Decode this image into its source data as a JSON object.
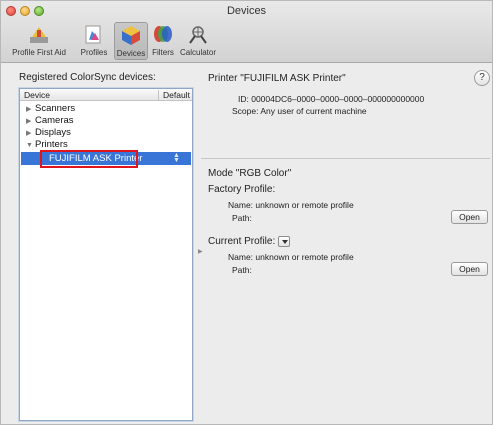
{
  "window": {
    "title": "Devices"
  },
  "toolbar": {
    "items": [
      {
        "label": "Profile First Aid",
        "icon": "first-aid-icon"
      },
      {
        "label": "Profiles",
        "icon": "profiles-icon"
      },
      {
        "label": "Devices",
        "icon": "devices-icon",
        "selected": true
      },
      {
        "label": "Filters",
        "icon": "filters-icon"
      },
      {
        "label": "Calculator",
        "icon": "calculator-icon"
      }
    ]
  },
  "left": {
    "title": "Registered ColorSync devices:",
    "columns": {
      "device": "Device",
      "default": "Default"
    },
    "tree": [
      {
        "label": "Scanners",
        "expanded": false
      },
      {
        "label": "Cameras",
        "expanded": false
      },
      {
        "label": "Displays",
        "expanded": false
      },
      {
        "label": "Printers",
        "expanded": true
      }
    ],
    "selected_item": "FUJIFILM ASK Printer"
  },
  "right": {
    "title": "Printer \"FUJIFILM ASK Printer\"",
    "help": "?",
    "id_line": "ID: 00004DC6–0000–0000–0000–000000000000",
    "scope_line": "Scope: Any user of current machine",
    "mode": "Mode \"RGB Color\"",
    "factory": {
      "heading": "Factory Profile:",
      "name": "Name: unknown or remote profile",
      "path": "Path:",
      "open": "Open"
    },
    "current": {
      "heading": "Current Profile:",
      "name": "Name: unknown or remote profile",
      "path": "Path:",
      "open": "Open"
    }
  },
  "colors": {
    "selection": "#3875d7",
    "annotation": "#e0151c"
  }
}
